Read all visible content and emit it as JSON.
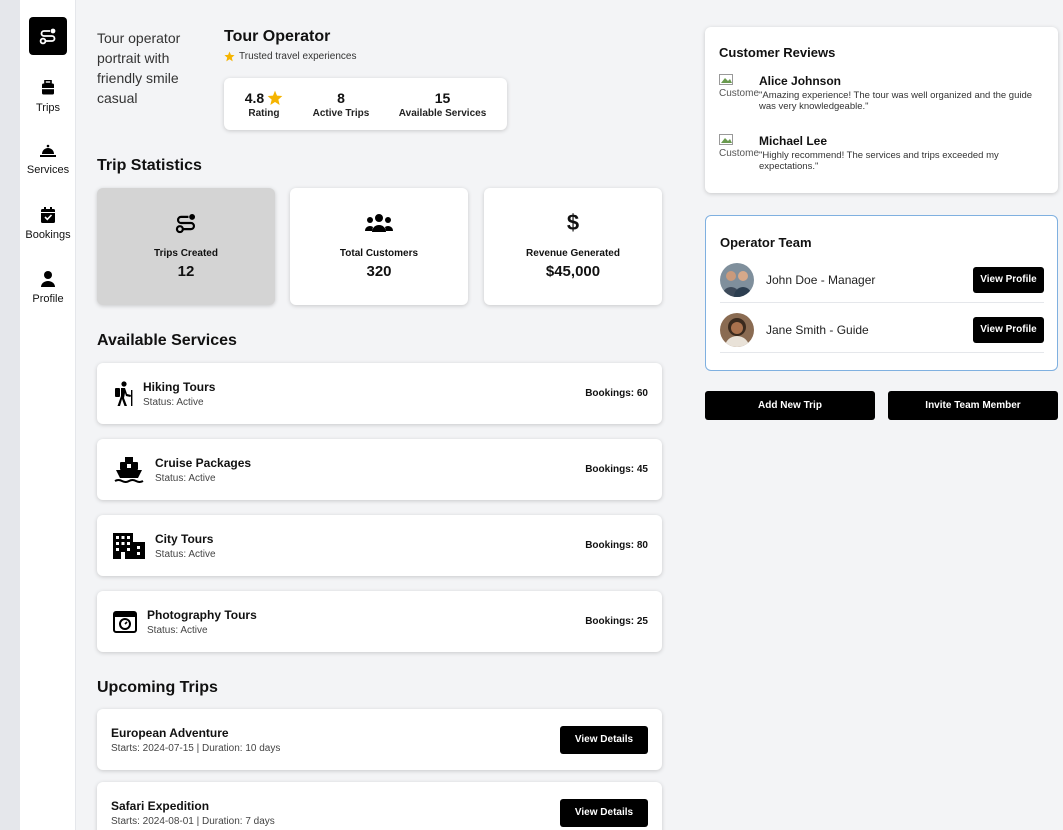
{
  "sidebar": {
    "items": [
      {
        "label": "Trips",
        "icon": "suitcase-icon"
      },
      {
        "label": "Services",
        "icon": "bell-icon"
      },
      {
        "label": "Bookings",
        "icon": "calendar-check-icon"
      },
      {
        "label": "Profile",
        "icon": "user-icon"
      }
    ]
  },
  "header": {
    "photo_alt": "Tour operator portrait with friendly smile casual",
    "title": "Tour Operator",
    "tagline": "Trusted travel experiences",
    "stats": [
      {
        "value": "4.8",
        "label": "Rating"
      },
      {
        "value": "8",
        "label": "Active Trips"
      },
      {
        "value": "15",
        "label": "Available Services"
      }
    ]
  },
  "trip_statistics": {
    "heading": "Trip Statistics",
    "cards": [
      {
        "label": "Trips Created",
        "value": "12",
        "icon": "route-icon"
      },
      {
        "label": "Total Customers",
        "value": "320",
        "icon": "users-icon"
      },
      {
        "label": "Revenue Generated",
        "value": "$45,000",
        "icon": "dollar-icon"
      }
    ]
  },
  "services": {
    "heading": "Available Services",
    "items": [
      {
        "name": "Hiking Tours",
        "status": "Status: Active",
        "bookings": "Bookings: 60",
        "icon": "hiking-icon"
      },
      {
        "name": "Cruise Packages",
        "status": "Status: Active",
        "bookings": "Bookings: 45",
        "icon": "ship-icon"
      },
      {
        "name": "City Tours",
        "status": "Status: Active",
        "bookings": "Bookings: 80",
        "icon": "city-icon"
      },
      {
        "name": "Photography Tours",
        "status": "Status: Active",
        "bookings": "Bookings: 25",
        "icon": "camera-icon"
      }
    ]
  },
  "upcoming": {
    "heading": "Upcoming Trips",
    "trips": [
      {
        "name": "European Adventure",
        "meta": "Starts: 2024-07-15 | Duration: 10 days",
        "button": "View Details"
      },
      {
        "name": "Safari Expedition",
        "meta": "Starts: 2024-08-01 | Duration: 7 days",
        "button": "View Details"
      }
    ]
  },
  "reviews": {
    "heading": "Customer Reviews",
    "avatar_alt": "Customer",
    "items": [
      {
        "name": "Alice Johnson",
        "text": "\"Amazing experience! The tour was well organized and the guide was very knowledgeable.\""
      },
      {
        "name": "Michael Lee",
        "text": "\"Highly recommend! The services and trips exceeded my expectations.\""
      }
    ]
  },
  "team": {
    "heading": "Operator Team",
    "members": [
      {
        "name": "John Doe - Manager",
        "button": "View Profile"
      },
      {
        "name": "Jane Smith - Guide",
        "button": "View Profile"
      }
    ]
  },
  "actions": {
    "add_trip": "Add New Trip",
    "invite": "Invite Team Member"
  },
  "colors": {
    "accent": "#000000",
    "star": "#f5b400",
    "team_border": "#7fb0e0",
    "active_card": "#d4d4d4"
  }
}
